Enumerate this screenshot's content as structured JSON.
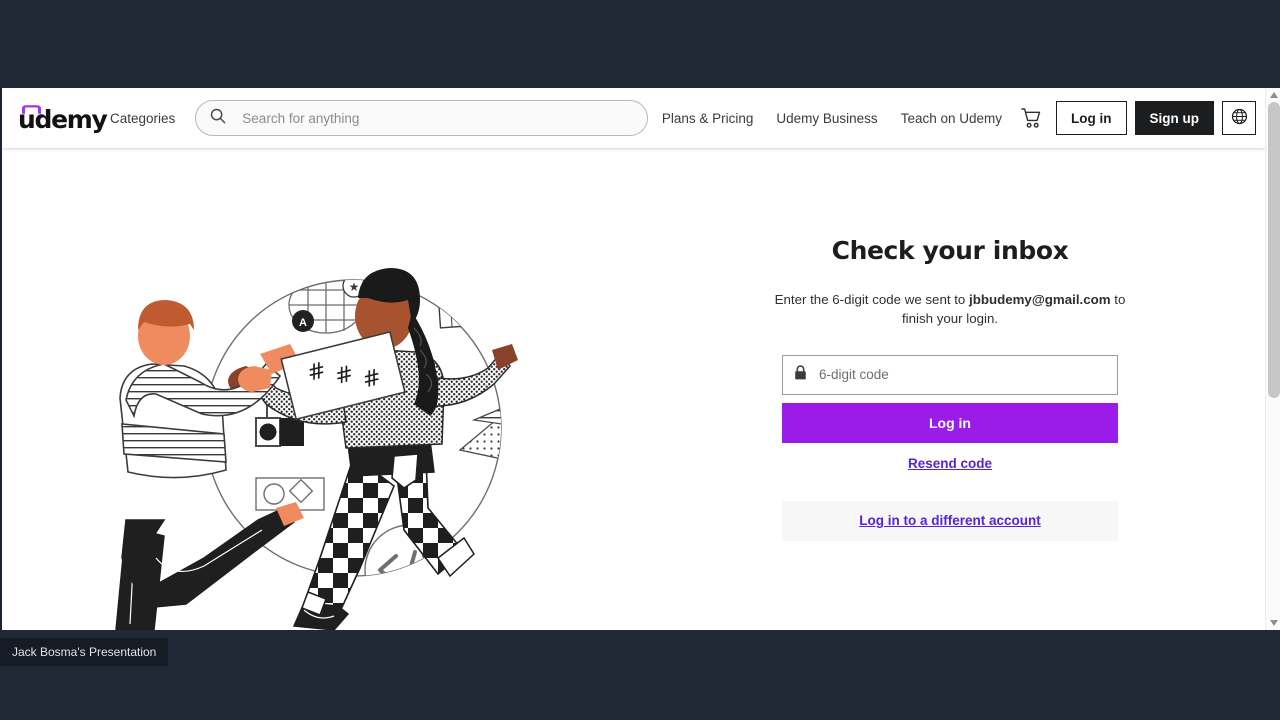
{
  "header": {
    "logo_text": "udemy",
    "categories_label": "Categories",
    "search": {
      "placeholder": "Search for anything",
      "value": "",
      "icon": "search-icon"
    },
    "nav_links": [
      {
        "label": "Plans & Pricing"
      },
      {
        "label": "Udemy Business"
      },
      {
        "label": "Teach on Udemy"
      }
    ],
    "cart_icon": "shopping-cart-icon",
    "login_label": "Log in",
    "signup_label": "Sign up",
    "language_icon": "globe-icon",
    "accent_color": "#a435f0"
  },
  "main": {
    "title": "Check your inbox",
    "subtitle_prefix": "Enter the 6-digit code we sent to ",
    "email": "jbbudemy@gmail.com",
    "subtitle_suffix": " to finish your login.",
    "code_field": {
      "placeholder": "6-digit code",
      "value": "",
      "icon": "lock-icon"
    },
    "submit_label": "Log in",
    "submit_color": "#9b1ce8",
    "resend_label": "Resend code",
    "alt_account_label": "Log in to a different account",
    "link_color": "#5624d0",
    "illustration_name": "two-people-exchanging-code-card-illustration"
  },
  "scrollbar": {
    "up_arrow": "chevron-up-icon",
    "down_arrow": "chevron-down-icon"
  },
  "taskbar": {
    "item_label": "Jack Bosma's Presentation",
    "background": "#212936"
  }
}
